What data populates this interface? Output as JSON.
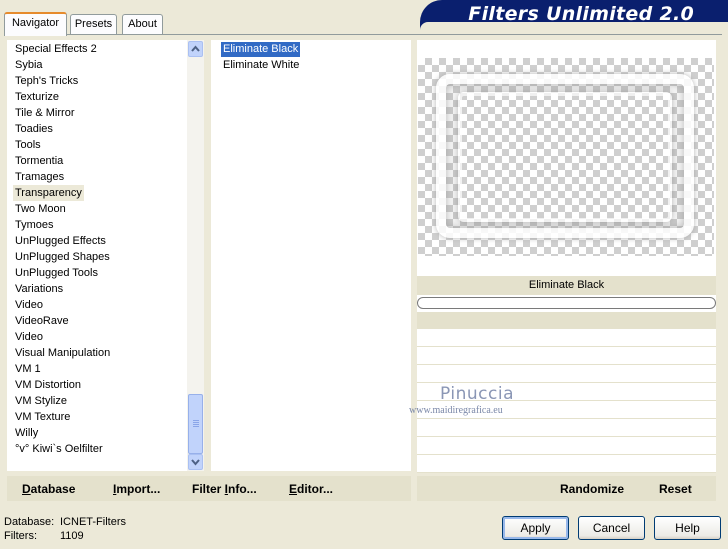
{
  "tabs": [
    "Navigator",
    "Presets",
    "About"
  ],
  "banner_title": "Filters Unlimited 2.0",
  "categories": [
    "Special Effects 2",
    "Sybia",
    "Teph's Tricks",
    "Texturize",
    "Tile & Mirror",
    "Toadies",
    "Tools",
    "Tormentia",
    "Tramages",
    "Transparency",
    "Two Moon",
    "Tymoes",
    "UnPlugged Effects",
    "UnPlugged Shapes",
    "UnPlugged Tools",
    "Variations",
    "Video",
    "VideoRave",
    "Video",
    "Visual Manipulation",
    "VM 1",
    "VM Distortion",
    "VM Stylize",
    "VM Texture",
    "Willy",
    "°v° Kiwi`s Oelfilter"
  ],
  "selected_category": "Transparency",
  "filters": [
    "Eliminate Black",
    "Eliminate White"
  ],
  "selected_filter": "Eliminate Black",
  "preview_label": "Eliminate Black",
  "watermark": {
    "name": "Pinuccia",
    "url": "www.maidiregrafica.eu"
  },
  "bottom_left": {
    "database": "Database",
    "import": "Import...",
    "filter_info": "Filter Info...",
    "editor": "Editor..."
  },
  "bottom_right": {
    "randomize": "Randomize",
    "reset": "Reset"
  },
  "status": {
    "database_label": "Database:",
    "database_value": "ICNET-Filters",
    "filters_label": "Filters:",
    "filters_value": "1109"
  },
  "buttons": {
    "apply": "Apply",
    "cancel": "Cancel",
    "help": "Help"
  }
}
